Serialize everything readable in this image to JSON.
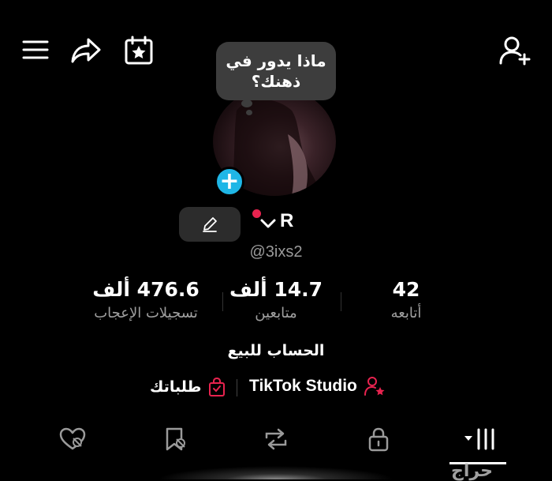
{
  "header": {
    "icons": [
      "menu-icon",
      "share-icon",
      "calendar-star-icon",
      "add-user-icon"
    ]
  },
  "avatar": {
    "bubble_line1": "ماذا يدور في",
    "bubble_line2": "ذهنك؟",
    "add_icon": "plus-icon"
  },
  "profile": {
    "display_name": "R",
    "username": "@3ixs2",
    "bio": "الحساب للبيع",
    "status_color": "#e8234f"
  },
  "stats": {
    "likes_value": "476.6 ألف",
    "likes_label": "تسجيلات الإعجاب",
    "followers_value": "14.7 ألف",
    "followers_label": "متابعين",
    "following_value": "42",
    "following_label": "أتابعه"
  },
  "links": {
    "studio_label": "TikTok Studio",
    "orders_label": "طلباتك",
    "accent": "#e8234f"
  },
  "tabs": [
    "liked-tab",
    "favorites-tab",
    "reposts-tab",
    "private-tab",
    "videos-tab"
  ],
  "watermark": "حراج"
}
